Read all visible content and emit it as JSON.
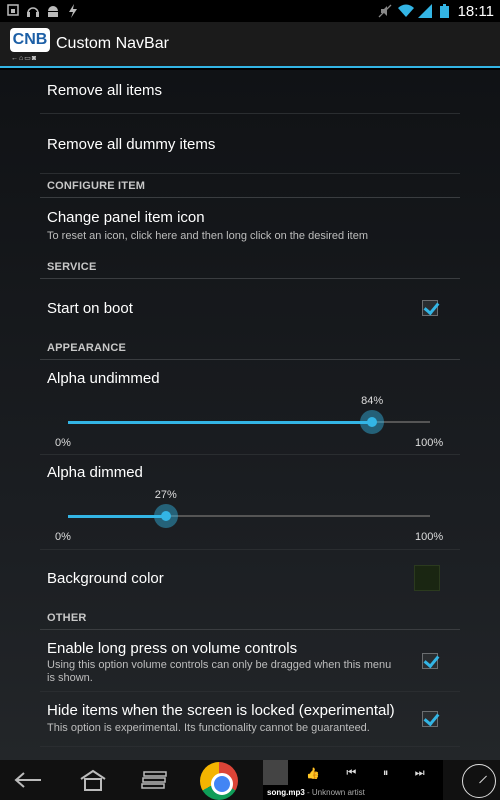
{
  "status_bar": {
    "time": "18:11",
    "icons_left": [
      "notification-icon",
      "headphones-icon",
      "android-icon",
      "bolt-icon"
    ],
    "icons_right": [
      "mute-icon",
      "wifi-icon",
      "signal-icon",
      "battery-icon"
    ]
  },
  "action_bar": {
    "logo_text": "CNB",
    "title": "Custom NavBar"
  },
  "settings": {
    "remove_all": "Remove all items",
    "remove_dummy": "Remove all dummy items",
    "cat_configure": "CONFIGURE ITEM",
    "change_icon_title": "Change panel item icon",
    "change_icon_sub": "To reset an icon, click here and then long click on the desired item",
    "cat_service": "SERVICE",
    "start_on_boot": "Start on boot",
    "start_on_boot_checked": true,
    "cat_appearance": "APPEARANCE",
    "alpha_undimmed": {
      "label": "Alpha undimmed",
      "value": 84,
      "value_text": "84%",
      "min": "0%",
      "max": "100%"
    },
    "alpha_dimmed": {
      "label": "Alpha dimmed",
      "value": 27,
      "value_text": "27%",
      "min": "0%",
      "max": "100%"
    },
    "background_color": "Background color",
    "background_color_value": "#1a2612",
    "cat_other": "OTHER",
    "long_press_title": "Enable long press on volume controls",
    "long_press_sub": "Using this option volume controls can only be dragged when this menu is shown.",
    "long_press_checked": true,
    "hide_locked_title": "Hide items when the screen is locked (experimental)",
    "hide_locked_sub": "This option is experimental. Its functionality cannot be guaranteed.",
    "hide_locked_checked": true
  },
  "nav_bar": {
    "buttons": [
      "back-icon",
      "home-icon",
      "recent-apps-icon",
      "chrome-icon"
    ],
    "music": {
      "song": "song.mp3",
      "artist": "Unknown artist",
      "controls": [
        "thumbs-up-icon",
        "previous-icon",
        "pause-icon",
        "next-icon"
      ]
    },
    "clock_icon": "clock-icon"
  },
  "colors": {
    "accent": "#33b5e5"
  }
}
